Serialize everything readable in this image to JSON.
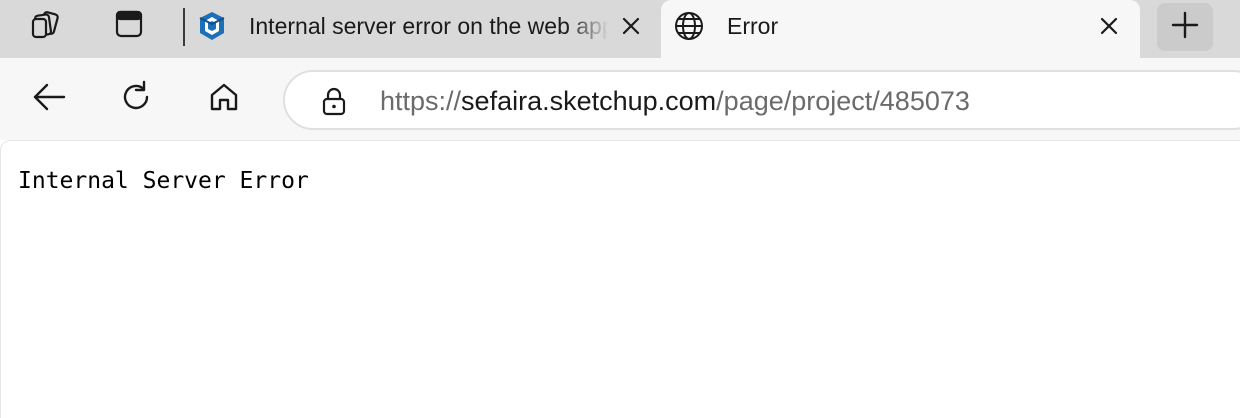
{
  "tabstrip": {
    "workspaces_icon": "tab-collection-icon",
    "tab_actions_icon": "vertical-tabs-icon",
    "tabs": [
      {
        "title": "Internal server error on the web app",
        "favicon": "sketchup-favicon-icon",
        "active": false
      },
      {
        "title": "Error",
        "favicon": "globe-icon",
        "active": true
      }
    ],
    "new_tab_icon": "plus-icon"
  },
  "toolbar": {
    "back_icon": "back-arrow-icon",
    "refresh_icon": "refresh-icon",
    "home_icon": "home-icon",
    "address": {
      "lock_icon": "lock-icon",
      "scheme": "https://",
      "host": "sefaira.sketchup.com",
      "path": "/page/project/485073"
    }
  },
  "page": {
    "body_text": "Internal Server Error"
  },
  "colors": {
    "tabstrip_bg": "#d9d9d9",
    "active_tab_bg": "#f7f7f7",
    "sketchup_blue": "#1d6fb8"
  }
}
